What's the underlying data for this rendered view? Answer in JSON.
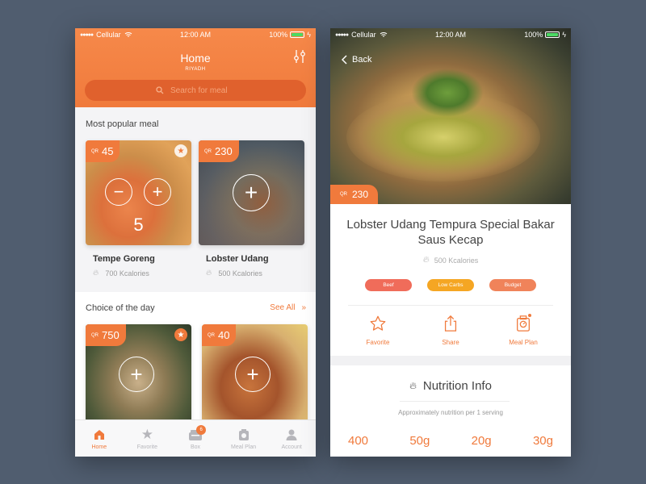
{
  "status_bar": {
    "carrier": "Cellular",
    "time": "12:00 AM",
    "battery": "100%"
  },
  "left": {
    "header": {
      "title": "Home",
      "subtitle": "RIYADH"
    },
    "search": {
      "placeholder": "Search for meal"
    },
    "popular": {
      "title": "Most popular meal",
      "cards": [
        {
          "currency": "QR",
          "price": "45",
          "name": "Tempe Goreng",
          "kcal": "700 Kcalories",
          "qty": "5"
        },
        {
          "currency": "QR",
          "price": "230",
          "name": "Lobster Udang",
          "kcal": "500 Kcalories"
        }
      ]
    },
    "choice": {
      "title": "Choice of the day",
      "see_all": "See All",
      "cards": [
        {
          "currency": "QR",
          "price": "750"
        },
        {
          "currency": "QR",
          "price": "40"
        }
      ]
    },
    "tabs": [
      {
        "label": "Home",
        "icon": "home-icon"
      },
      {
        "label": "Favorite",
        "icon": "star-icon"
      },
      {
        "label": "Box",
        "icon": "box-icon",
        "badge": "6"
      },
      {
        "label": "Meal Plan",
        "icon": "scale-icon"
      },
      {
        "label": "Account",
        "icon": "user-icon"
      }
    ]
  },
  "right": {
    "back_label": "Back",
    "hero_badge": {
      "currency": "QR",
      "price": "230"
    },
    "dish": {
      "title": "Lobster Udang Tempura Special Bakar Saus Kecap",
      "kcal": "500 Kcalories"
    },
    "tags": [
      {
        "label": "Beef",
        "color": "#f06c5a"
      },
      {
        "label": "Low Carbs",
        "color": "#f5a623"
      },
      {
        "label": "Budget",
        "color": "#f0835a"
      }
    ],
    "actions": [
      {
        "label": "Favorite",
        "icon": "star-outline-icon"
      },
      {
        "label": "Share",
        "icon": "share-icon"
      },
      {
        "label": "Meal Plan",
        "icon": "scale-icon"
      }
    ],
    "nutrition": {
      "title": "Nutrition Info",
      "subtitle": "Approximately nutrition per 1 serving",
      "values": [
        "400",
        "50g",
        "20g",
        "30g"
      ]
    }
  },
  "colors": {
    "accent": "#f07a3c",
    "background": "#505d6f"
  }
}
